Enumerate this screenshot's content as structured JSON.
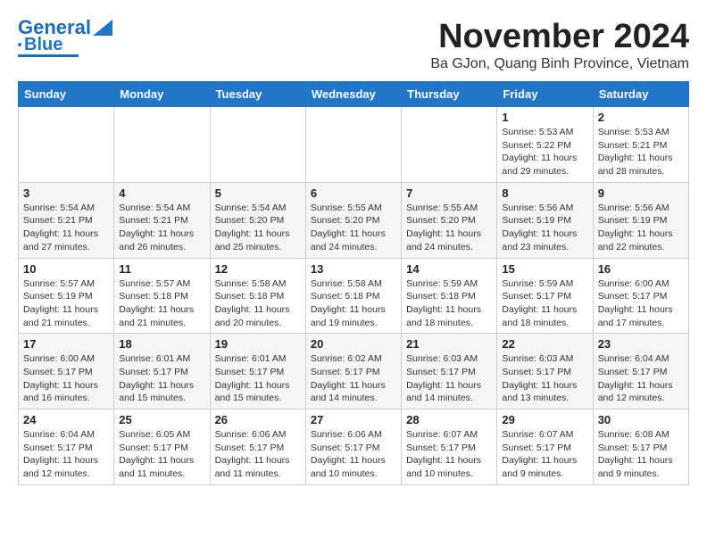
{
  "header": {
    "logo_line1": "General",
    "logo_line2": "Blue",
    "month": "November 2024",
    "location": "Ba GJon, Quang Binh Province, Vietnam"
  },
  "weekdays": [
    "Sunday",
    "Monday",
    "Tuesday",
    "Wednesday",
    "Thursday",
    "Friday",
    "Saturday"
  ],
  "weeks": [
    [
      {
        "day": "",
        "info": ""
      },
      {
        "day": "",
        "info": ""
      },
      {
        "day": "",
        "info": ""
      },
      {
        "day": "",
        "info": ""
      },
      {
        "day": "",
        "info": ""
      },
      {
        "day": "1",
        "info": "Sunrise: 5:53 AM\nSunset: 5:22 PM\nDaylight: 11 hours and 29 minutes."
      },
      {
        "day": "2",
        "info": "Sunrise: 5:53 AM\nSunset: 5:21 PM\nDaylight: 11 hours and 28 minutes."
      }
    ],
    [
      {
        "day": "3",
        "info": "Sunrise: 5:54 AM\nSunset: 5:21 PM\nDaylight: 11 hours and 27 minutes."
      },
      {
        "day": "4",
        "info": "Sunrise: 5:54 AM\nSunset: 5:21 PM\nDaylight: 11 hours and 26 minutes."
      },
      {
        "day": "5",
        "info": "Sunrise: 5:54 AM\nSunset: 5:20 PM\nDaylight: 11 hours and 25 minutes."
      },
      {
        "day": "6",
        "info": "Sunrise: 5:55 AM\nSunset: 5:20 PM\nDaylight: 11 hours and 24 minutes."
      },
      {
        "day": "7",
        "info": "Sunrise: 5:55 AM\nSunset: 5:20 PM\nDaylight: 11 hours and 24 minutes."
      },
      {
        "day": "8",
        "info": "Sunrise: 5:56 AM\nSunset: 5:19 PM\nDaylight: 11 hours and 23 minutes."
      },
      {
        "day": "9",
        "info": "Sunrise: 5:56 AM\nSunset: 5:19 PM\nDaylight: 11 hours and 22 minutes."
      }
    ],
    [
      {
        "day": "10",
        "info": "Sunrise: 5:57 AM\nSunset: 5:19 PM\nDaylight: 11 hours and 21 minutes."
      },
      {
        "day": "11",
        "info": "Sunrise: 5:57 AM\nSunset: 5:18 PM\nDaylight: 11 hours and 21 minutes."
      },
      {
        "day": "12",
        "info": "Sunrise: 5:58 AM\nSunset: 5:18 PM\nDaylight: 11 hours and 20 minutes."
      },
      {
        "day": "13",
        "info": "Sunrise: 5:58 AM\nSunset: 5:18 PM\nDaylight: 11 hours and 19 minutes."
      },
      {
        "day": "14",
        "info": "Sunrise: 5:59 AM\nSunset: 5:18 PM\nDaylight: 11 hours and 18 minutes."
      },
      {
        "day": "15",
        "info": "Sunrise: 5:59 AM\nSunset: 5:17 PM\nDaylight: 11 hours and 18 minutes."
      },
      {
        "day": "16",
        "info": "Sunrise: 6:00 AM\nSunset: 5:17 PM\nDaylight: 11 hours and 17 minutes."
      }
    ],
    [
      {
        "day": "17",
        "info": "Sunrise: 6:00 AM\nSunset: 5:17 PM\nDaylight: 11 hours and 16 minutes."
      },
      {
        "day": "18",
        "info": "Sunrise: 6:01 AM\nSunset: 5:17 PM\nDaylight: 11 hours and 15 minutes."
      },
      {
        "day": "19",
        "info": "Sunrise: 6:01 AM\nSunset: 5:17 PM\nDaylight: 11 hours and 15 minutes."
      },
      {
        "day": "20",
        "info": "Sunrise: 6:02 AM\nSunset: 5:17 PM\nDaylight: 11 hours and 14 minutes."
      },
      {
        "day": "21",
        "info": "Sunrise: 6:03 AM\nSunset: 5:17 PM\nDaylight: 11 hours and 14 minutes."
      },
      {
        "day": "22",
        "info": "Sunrise: 6:03 AM\nSunset: 5:17 PM\nDaylight: 11 hours and 13 minutes."
      },
      {
        "day": "23",
        "info": "Sunrise: 6:04 AM\nSunset: 5:17 PM\nDaylight: 11 hours and 12 minutes."
      }
    ],
    [
      {
        "day": "24",
        "info": "Sunrise: 6:04 AM\nSunset: 5:17 PM\nDaylight: 11 hours and 12 minutes."
      },
      {
        "day": "25",
        "info": "Sunrise: 6:05 AM\nSunset: 5:17 PM\nDaylight: 11 hours and 11 minutes."
      },
      {
        "day": "26",
        "info": "Sunrise: 6:06 AM\nSunset: 5:17 PM\nDaylight: 11 hours and 11 minutes."
      },
      {
        "day": "27",
        "info": "Sunrise: 6:06 AM\nSunset: 5:17 PM\nDaylight: 11 hours and 10 minutes."
      },
      {
        "day": "28",
        "info": "Sunrise: 6:07 AM\nSunset: 5:17 PM\nDaylight: 11 hours and 10 minutes."
      },
      {
        "day": "29",
        "info": "Sunrise: 6:07 AM\nSunset: 5:17 PM\nDaylight: 11 hours and 9 minutes."
      },
      {
        "day": "30",
        "info": "Sunrise: 6:08 AM\nSunset: 5:17 PM\nDaylight: 11 hours and 9 minutes."
      }
    ]
  ]
}
